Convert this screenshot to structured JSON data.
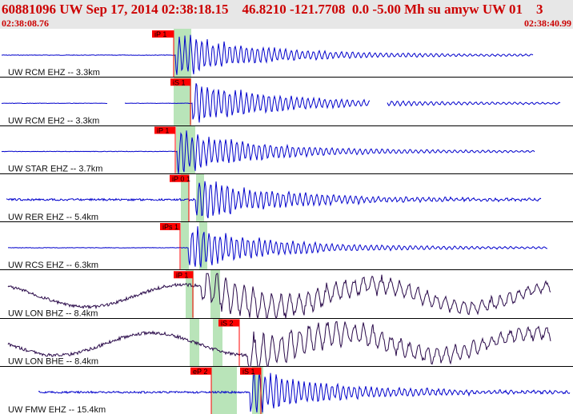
{
  "header": {
    "title": "60881096 UW Sep 17, 2014 02:38:18.15    46.8210 -121.7708  0.0 -5.00 Mh su amyw UW 01    3",
    "start_time": "02:38:08.76",
    "end_time": "02:38:40.99"
  },
  "colors": {
    "header_bg": "#e7e7e7",
    "header_text": "#cc0000",
    "trace_blue": "#0000cc",
    "trace_dark": "#2a0a4a",
    "pick_box": "#ff0000",
    "pick_line": "#ff0000",
    "window_fill": "#b9e4b9",
    "separator": "#000000"
  },
  "traces": [
    {
      "label": "UW RCM EHZ -- 3.3km",
      "pick": "iP 1",
      "color": "blue",
      "style": "sharp",
      "onset": 0.3,
      "gaps": []
    },
    {
      "label": "UW RCM EH2 -- 3.3km",
      "pick": "iS 1",
      "color": "blue",
      "style": "sharp",
      "onset": 0.33,
      "gaps": [
        [
          0.19,
          0.22
        ],
        [
          0.66,
          0.69
        ]
      ]
    },
    {
      "label": "UW STAR EHZ -- 3.7km",
      "pick": "iP 1",
      "color": "blue",
      "style": "sharp",
      "onset": 0.31,
      "gaps": []
    },
    {
      "label": "UW RER EHZ -- 5.4km",
      "pick": "iP 0 1",
      "color": "blue",
      "style": "noisy",
      "onset": 0.33,
      "gaps": []
    },
    {
      "label": "UW RCS EHZ -- 6.3km",
      "pick": "iPs 1",
      "color": "blue",
      "style": "sharp",
      "onset": 0.32,
      "gaps": []
    },
    {
      "label": "UW LON BHZ -- 8.4km",
      "pick": "iP 1",
      "color": "dark",
      "style": "long",
      "onset": 0.34,
      "gaps": []
    },
    {
      "label": "UW LON BHE -- 8.4km",
      "pick": "iS 2",
      "color": "dark",
      "style": "long",
      "onset": 0.42,
      "gaps": []
    },
    {
      "label": "UW FMW EHZ -- 15.4km",
      "pick_p": "eP 2",
      "pick_s": "iS 1",
      "color": "blue",
      "style": "noisy",
      "onset": 0.37,
      "gaps": []
    }
  ]
}
